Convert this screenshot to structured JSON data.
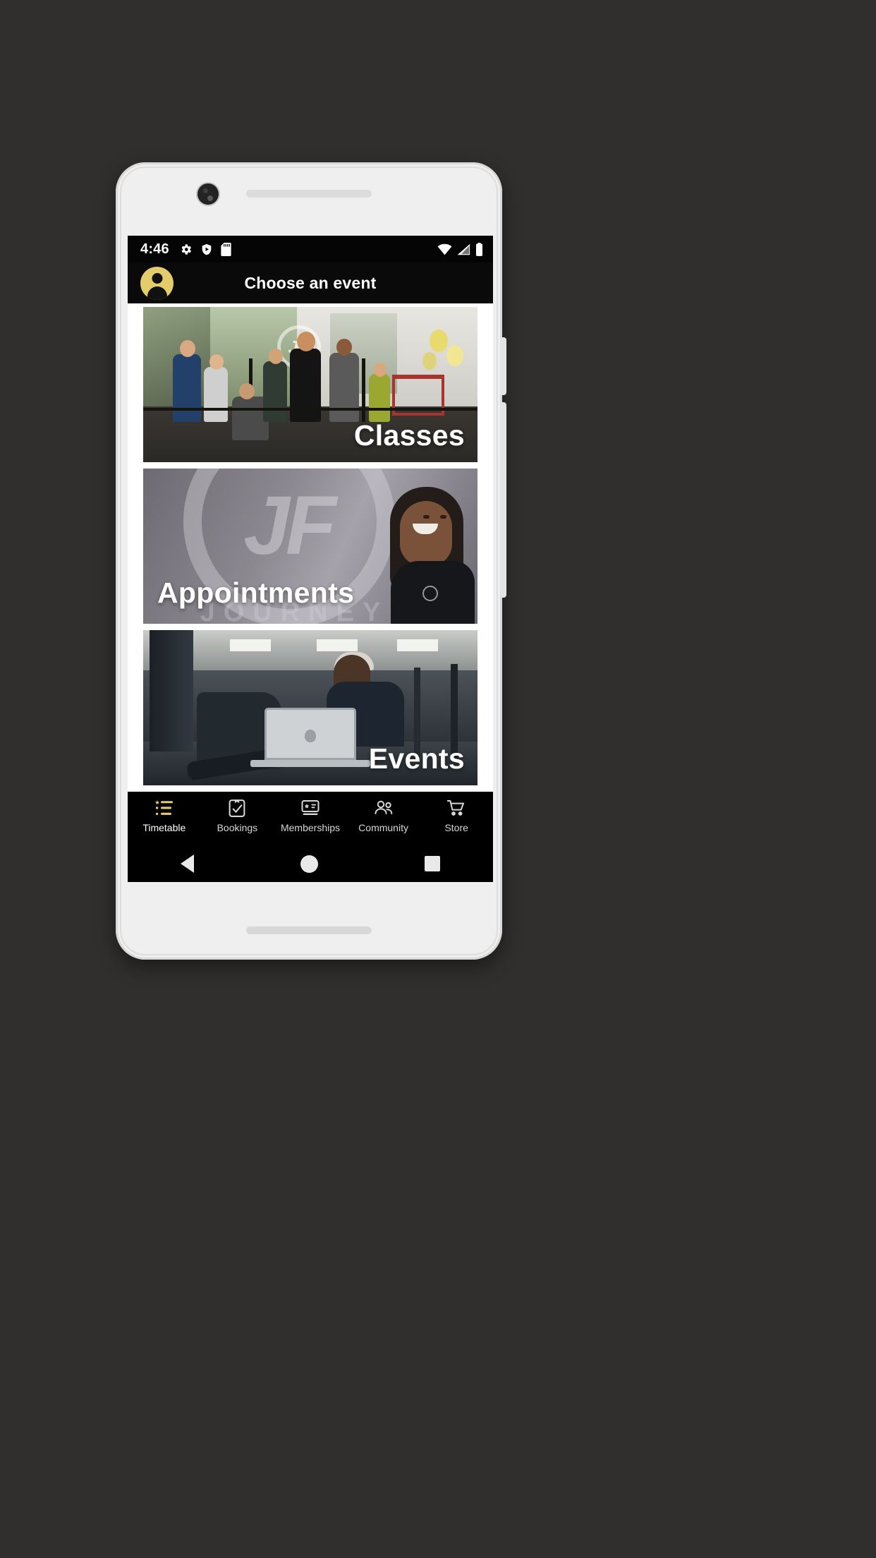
{
  "device": {
    "frame_color": "#efefef",
    "background_color": "#302f2e"
  },
  "status_bar": {
    "time": "4:46",
    "left_icons": [
      "gear-icon",
      "shield-play-icon",
      "sd-card-icon"
    ],
    "right_icons": [
      "wifi-icon",
      "cellular-signal-icon",
      "battery-icon"
    ],
    "background_color": "#050505",
    "foreground_color": "#ffffff"
  },
  "app_bar": {
    "title": "Choose an event",
    "avatar_icon": "account-avatar-icon",
    "avatar_color": "#e3cc6a",
    "background_color": "#0a0a0a"
  },
  "cards": [
    {
      "label": "Classes",
      "image": "gym-group-class-photo",
      "label_align": "right"
    },
    {
      "label": "Appointments",
      "image": "personal-trainer-photo",
      "label_align": "left"
    },
    {
      "label": "Events",
      "image": "gym-staff-laptop-photo",
      "label_align": "right"
    }
  ],
  "card_overlays": {
    "classes_logo_text": "JF",
    "appointments_brand_mark": "JF",
    "appointments_brand_word": "JOURNEY"
  },
  "bottom_nav": {
    "active_color": "#e3cc6a",
    "inactive_color": "#d6d6d6",
    "items": [
      {
        "label": "Timetable",
        "icon": "star-list-icon",
        "active": true
      },
      {
        "label": "Bookings",
        "icon": "clipboard-check-icon",
        "active": false
      },
      {
        "label": "Memberships",
        "icon": "membership-card-icon",
        "active": false
      },
      {
        "label": "Community",
        "icon": "people-group-icon",
        "active": false
      },
      {
        "label": "Store",
        "icon": "shopping-cart-icon",
        "active": false
      }
    ]
  },
  "system_nav": {
    "items": [
      {
        "name": "back-button",
        "icon": "triangle-back-icon"
      },
      {
        "name": "home-button",
        "icon": "circle-home-icon"
      },
      {
        "name": "recents-button",
        "icon": "square-recents-icon"
      }
    ]
  }
}
